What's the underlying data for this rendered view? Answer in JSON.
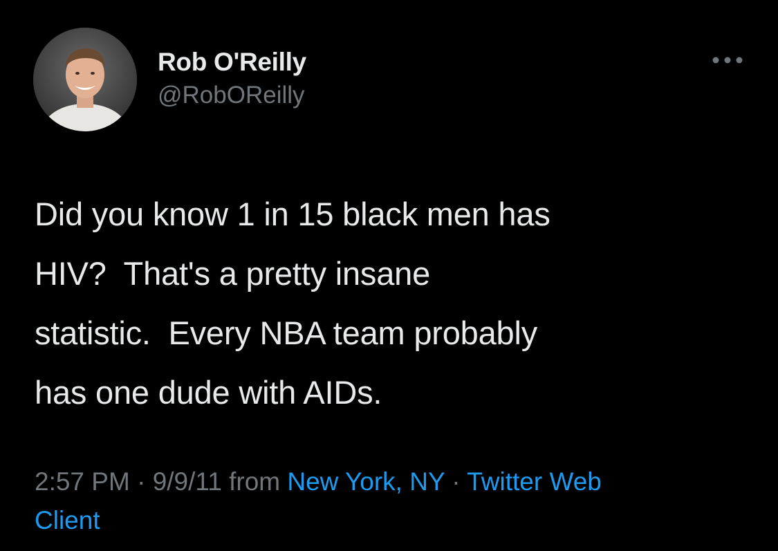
{
  "author": {
    "display_name": "Rob O'Reilly",
    "handle": "@RobOReilly",
    "avatar_icon": "user-avatar-photo"
  },
  "menu": {
    "more_icon": "more-horizontal-icon"
  },
  "tweet": {
    "text": "Did you know 1 in 15 black men has\nHIV?  That's a pretty insane\nstatistic.  Every NBA team probably\nhas one dude with AIDs."
  },
  "meta": {
    "time": "2:57 PM",
    "separator": "·",
    "date": "9/9/11",
    "from_label": "from",
    "location": "New York, NY",
    "client_part1": "Twitter Web",
    "client_part2": "Client"
  },
  "colors": {
    "background": "#000000",
    "text": "#e7e9ea",
    "muted": "#71767b",
    "link": "#1d9bf0"
  }
}
